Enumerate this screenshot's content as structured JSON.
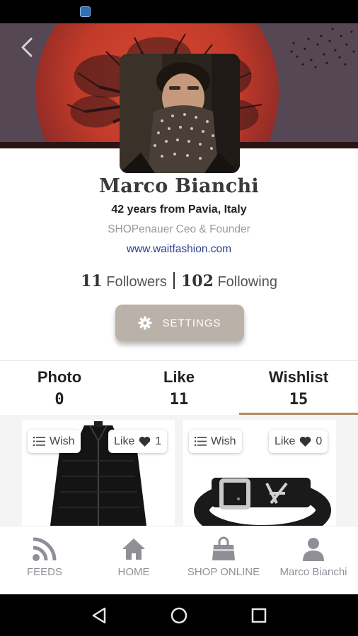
{
  "profile": {
    "name": "Marco Bianchi",
    "subtitle": "42 years from Pavia, Italy",
    "role": "SHOPenauer Ceo & Founder",
    "website": "www.waitfashion.com"
  },
  "follow": {
    "followers_count": "11",
    "followers_label": "Followers",
    "following_count": "102",
    "following_label": "Following"
  },
  "settings_button": {
    "label": "SETTINGS",
    "icon": "gear-icon"
  },
  "tabs": [
    {
      "label": "Photo",
      "count": "0"
    },
    {
      "label": "Like",
      "count": "11"
    },
    {
      "label": "Wishlist",
      "count": "15",
      "active": true
    }
  ],
  "products": [
    {
      "wish_label": "Wish",
      "like_label": "Like",
      "like_count": "1",
      "item": "puffer-jacket"
    },
    {
      "wish_label": "Wish",
      "like_label": "Like",
      "like_count": "0",
      "item": "leather-belt"
    }
  ],
  "bottom_nav": [
    {
      "label": "FEEDS",
      "icon": "rss-icon"
    },
    {
      "label": "HOME",
      "icon": "home-icon"
    },
    {
      "label": "SHOP ONLINE",
      "icon": "shopping-bag-icon"
    },
    {
      "label": "Marco Bianchi",
      "icon": "user-icon"
    }
  ],
  "colors": {
    "settings_button": "#bab2a8",
    "tab_indicator": "#b48a5e",
    "website_link": "#2f3f8f",
    "nav_icon": "#8f8f98"
  }
}
